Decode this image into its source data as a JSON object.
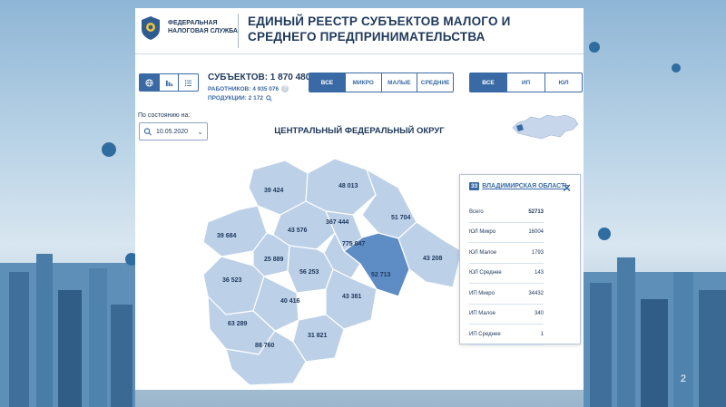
{
  "slide_number": "2",
  "header": {
    "org_line1": "ФЕДЕРАЛЬНАЯ",
    "org_line2": "НАЛОГОВАЯ СЛУЖБА",
    "title": "ЕДИНЫЙ РЕЕСТР СУБЪЕКТОВ МАЛОГО И СРЕДНЕГО ПРЕДПРИНИМАТЕЛЬСТВА"
  },
  "toolbar": {
    "view_icons": [
      "globe-icon",
      "bar-chart-icon",
      "list-icon"
    ],
    "subjects_label": "СУБЪЕКТОВ: 1 870 480",
    "workers_label": "РАБОТНИКОВ: 4 935 076",
    "products_label": "ПРОДУКЦИИ: 2 172",
    "size_filters": [
      "ВСЕ",
      "МИКРО",
      "МАЛЫЕ",
      "СРЕДНИЕ"
    ],
    "type_filters": [
      "ВСЕ",
      "ИП",
      "ЮЛ"
    ],
    "as_of_label": "По состоянию на:",
    "date_value": "10.05.2020"
  },
  "district_title": "ЦЕНТРАЛЬНЫЙ ФЕДЕРАЛЬНЫЙ ОКРУГ",
  "colors": {
    "accent": "#3a6aa6",
    "region_fill": "#bcd0e8",
    "region_selected": "#5e8cc4",
    "text": "#203a5c"
  },
  "map_labels": [
    "39 424",
    "48 013",
    "39 684",
    "43 576",
    "367 444",
    "51 704",
    "775 047",
    "25 889",
    "43 208",
    "36 523",
    "56 253",
    "52 713",
    "40 416",
    "43 381",
    "63 289",
    "31 821",
    "88 760"
  ],
  "popup": {
    "badge": "33",
    "region": "ВЛАДИМИРСКАЯ ОБЛАСТЬ",
    "rows": [
      {
        "label": "Всего",
        "value": "52713"
      },
      {
        "label": "ЮЛ Микро",
        "value": "16004"
      },
      {
        "label": "ЮЛ Малое",
        "value": "1793"
      },
      {
        "label": "ЮЛ Среднее",
        "value": "143"
      },
      {
        "label": "ИП Микро",
        "value": "34432"
      },
      {
        "label": "ИП Малое",
        "value": "340"
      },
      {
        "label": "ИП Среднее",
        "value": "1"
      }
    ]
  }
}
